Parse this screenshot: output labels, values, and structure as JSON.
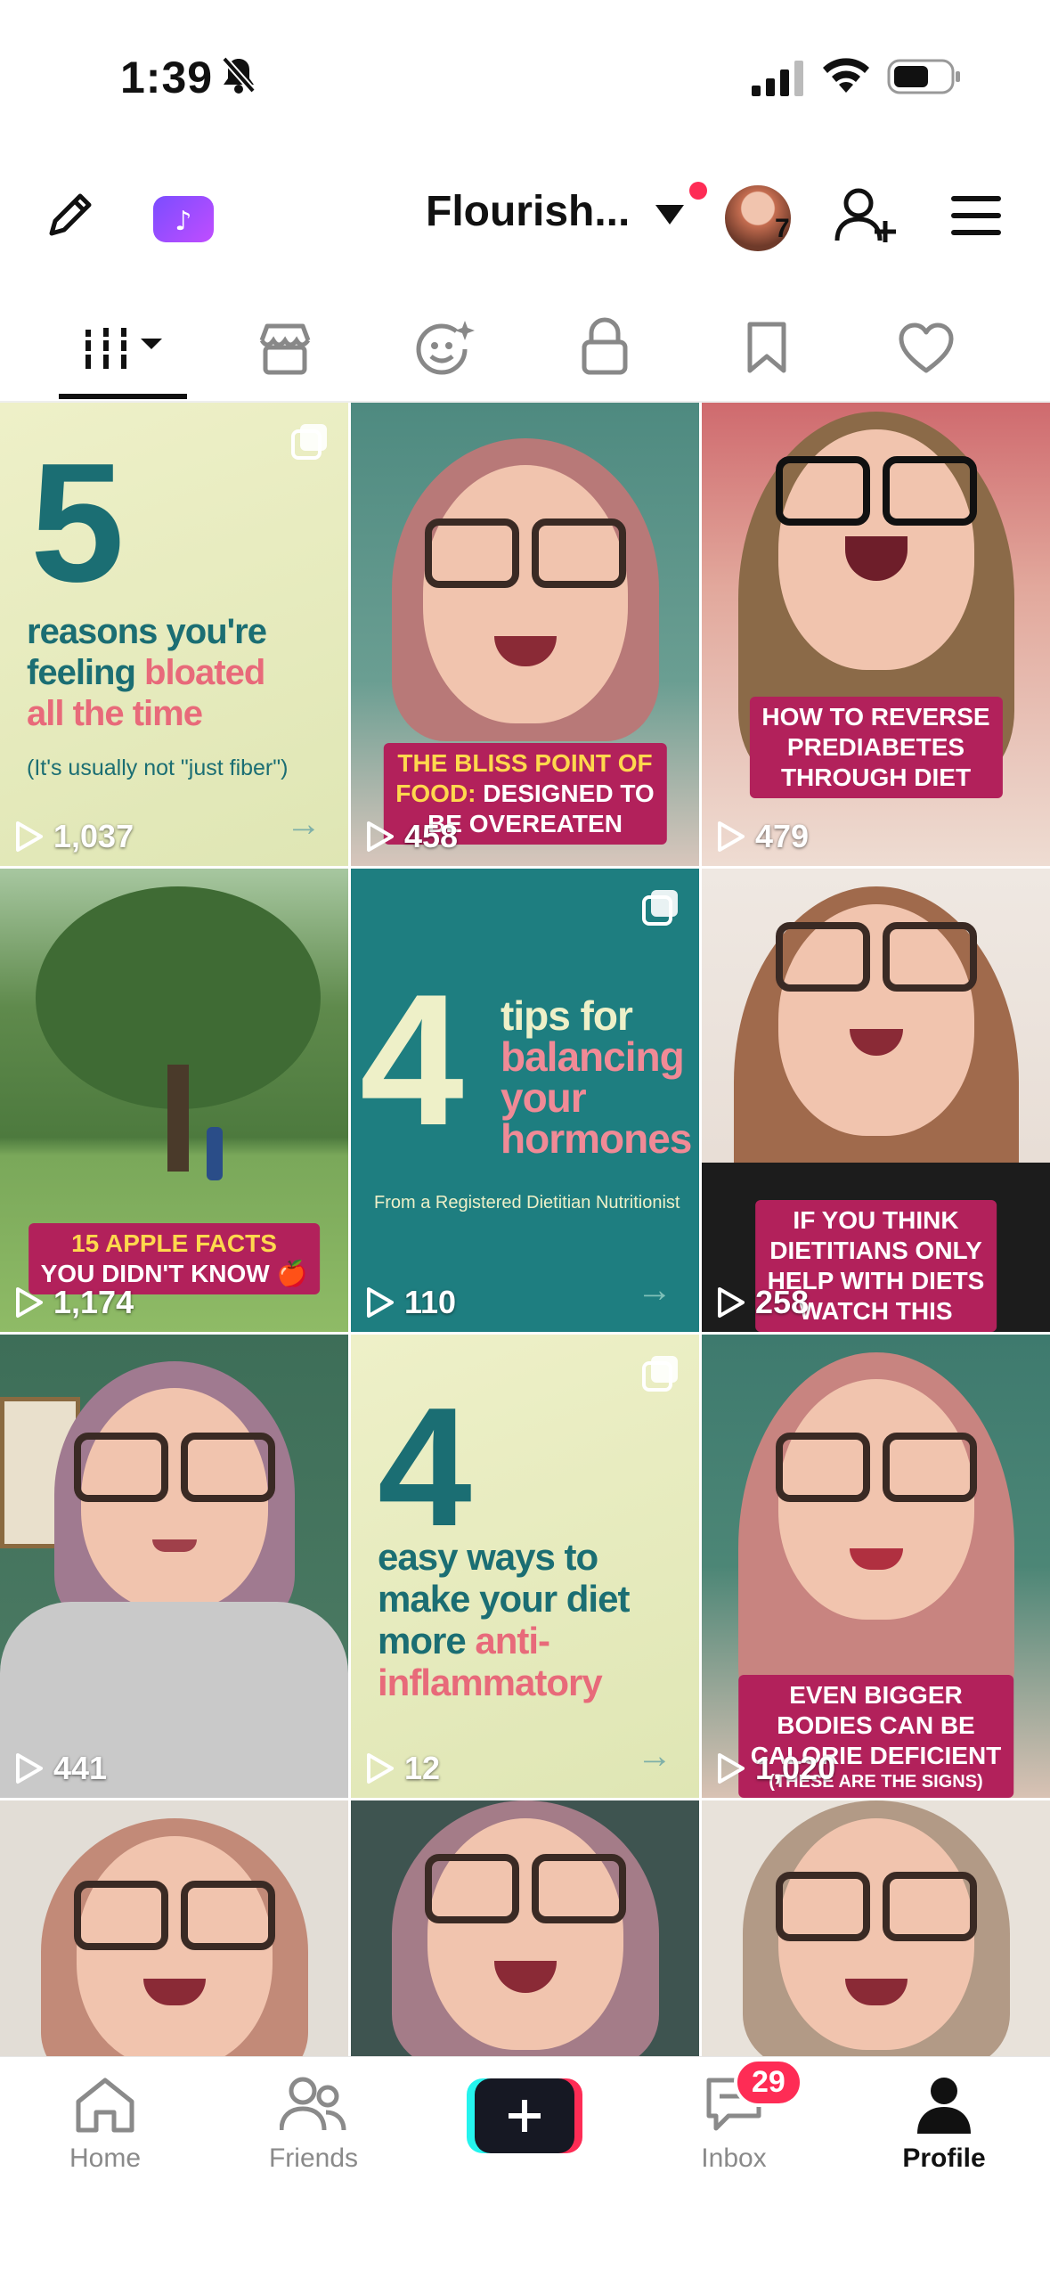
{
  "status_bar": {
    "time": "1:39"
  },
  "header": {
    "title": "Flourish...",
    "following_badge_count": "7"
  },
  "tiles": [
    {
      "views": "1,037",
      "headline_number": "5",
      "line1": "reasons you're",
      "line2a": "feeling ",
      "line2b": "bloated",
      "line3": "all the time",
      "sub": "(It's usually not \"just fiber\")"
    },
    {
      "views": "458",
      "caption_l1a": "THE BLISS POINT OF",
      "caption_l2a": "FOOD:",
      "caption_l2b": " DESIGNED TO",
      "caption_l3": "BE OVEREATEN"
    },
    {
      "views": "479",
      "caption_l1": "HOW TO REVERSE",
      "caption_l2": "PREDIABETES",
      "caption_l3": "THROUGH DIET"
    },
    {
      "views": "1,174",
      "caption_l1": "15 APPLE FACTS",
      "caption_l2": "YOU DIDN'T KNOW 🍎"
    },
    {
      "views": "110",
      "headline_number": "4",
      "line1": "tips for",
      "line2": "balancing",
      "line3": "your",
      "line4": "hormones",
      "sub": "From a Registered Dietitian Nutritionist"
    },
    {
      "views": "258",
      "caption_l1": "IF YOU THINK",
      "caption_l2": "DIETITIANS ONLY",
      "caption_l3": "HELP WITH DIETS",
      "caption_l4": "WATCH THIS"
    },
    {
      "views": "441"
    },
    {
      "views": "12",
      "headline_number": "4",
      "line1": "easy ways to",
      "line2": "make your diet",
      "line3a": "more ",
      "line3b": "anti-",
      "line4": "inflammatory"
    },
    {
      "views": "1,020",
      "caption_l1": "EVEN BIGGER",
      "caption_l2": "BODIES CAN BE",
      "caption_l3": "CALORIE DEFICIENT",
      "caption_l4": "(THESE ARE THE SIGNS)"
    },
    {},
    {},
    {}
  ],
  "bottom_nav": {
    "home": "Home",
    "friends": "Friends",
    "inbox": "Inbox",
    "inbox_badge": "29",
    "profile": "Profile"
  },
  "colors": {
    "accent_red": "#fe2c55",
    "accent_cyan": "#25f4ee",
    "caption_pink": "#b2215b",
    "teal": "#1b6e73"
  }
}
